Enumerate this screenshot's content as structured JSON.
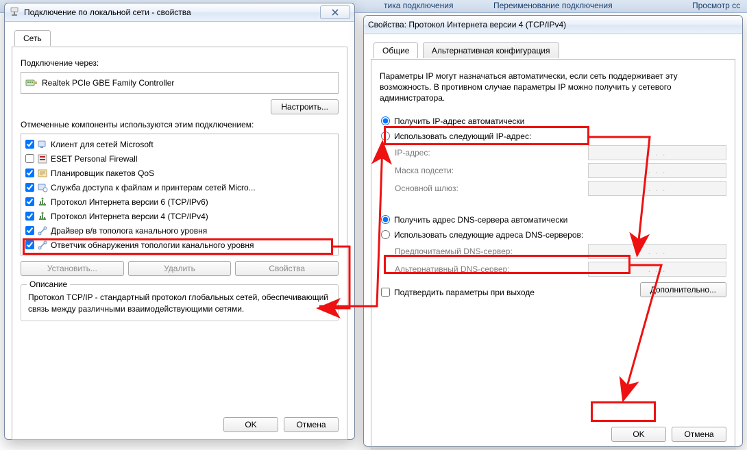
{
  "topbar": {
    "seg1": "тика подключения",
    "seg2": "Переименование подключения",
    "seg3": "Просмотр сс"
  },
  "left": {
    "title": "Подключение по локальной сети - свойства",
    "tab_network": "Сеть",
    "connect_label": "Подключение через:",
    "adapter": "Realtek PCIe GBE Family Controller",
    "configure": "Настроить...",
    "components_label": "Отмеченные компоненты используются этим подключением:",
    "items": [
      {
        "checked": true,
        "label": "Клиент для сетей Microsoft"
      },
      {
        "checked": false,
        "label": "ESET Personal Firewall"
      },
      {
        "checked": true,
        "label": "Планировщик пакетов QoS"
      },
      {
        "checked": true,
        "label": "Служба доступа к файлам и принтерам сетей Micro..."
      },
      {
        "checked": true,
        "label": "Протокол Интернета версии 6 (TCP/IPv6)"
      },
      {
        "checked": true,
        "label": "Протокол Интернета версии 4 (TCP/IPv4)"
      },
      {
        "checked": true,
        "label": "Драйвер в/в тополога канального уровня"
      },
      {
        "checked": true,
        "label": "Ответчик обнаружения топологии канального уровня"
      }
    ],
    "install": "Установить...",
    "remove": "Удалить",
    "properties": "Свойства",
    "desc_legend": "Описание",
    "desc_text": "Протокол TCP/IP - стандартный протокол глобальных сетей, обеспечивающий связь между различными взаимодействующими сетями.",
    "ok": "OK",
    "cancel": "Отмена"
  },
  "right": {
    "title": "Свойства: Протокол Интернета версии 4 (TCP/IPv4)",
    "tab_general": "Общие",
    "tab_alt": "Альтернативная конфигурация",
    "info": "Параметры IP могут назначаться автоматически, если сеть поддерживает эту возможность. В противном случае параметры IP можно получить у сетевого администратора.",
    "ip_auto": "Получить IP-адрес автоматически",
    "ip_manual": "Использовать следующий IP-адрес:",
    "ip_addr_label": "IP-адрес:",
    "mask_label": "Маска подсети:",
    "gw_label": "Основной шлюз:",
    "dns_auto": "Получить адрес DNS-сервера автоматически",
    "dns_manual": "Использовать следующие адреса DNS-серверов:",
    "dns_pref": "Предпочитаемый DNS-сервер:",
    "dns_alt": "Альтернативный DNS-сервер:",
    "confirm_exit": "Подтвердить параметры при выходе",
    "advanced": "Дополнительно...",
    "ok": "OK",
    "cancel": "Отмена",
    "ip_dots": ".       .       ."
  }
}
